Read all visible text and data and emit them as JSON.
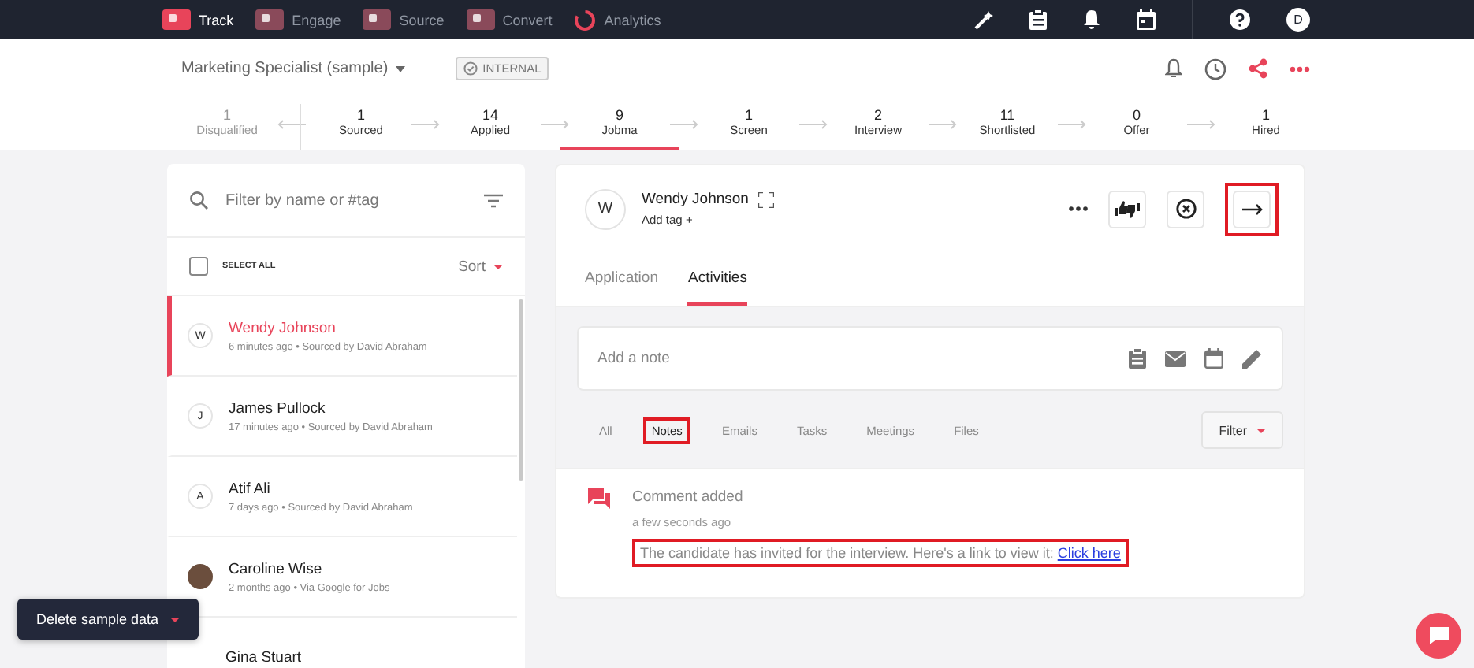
{
  "nav": {
    "items": [
      {
        "label": "Track",
        "selected": true
      },
      {
        "label": "Engage",
        "selected": false
      },
      {
        "label": "Source",
        "selected": false
      },
      {
        "label": "Convert",
        "selected": false
      },
      {
        "label": "Analytics",
        "selected": false
      }
    ],
    "avatar_initial": "D"
  },
  "job": {
    "title": "Marketing Specialist (sample)",
    "badge": "INTERNAL"
  },
  "stages": [
    {
      "count": "1",
      "label": "Disqualified",
      "kind": "rejected",
      "selected": false
    },
    {
      "count": "1",
      "label": "Sourced",
      "kind": "stage",
      "selected": false
    },
    {
      "count": "14",
      "label": "Applied",
      "kind": "stage",
      "selected": false
    },
    {
      "count": "9",
      "label": "Jobma",
      "kind": "stage",
      "selected": true
    },
    {
      "count": "1",
      "label": "Screen",
      "kind": "stage",
      "selected": false
    },
    {
      "count": "2",
      "label": "Interview",
      "kind": "stage",
      "selected": false
    },
    {
      "count": "11",
      "label": "Shortlisted",
      "kind": "stage",
      "selected": false
    },
    {
      "count": "0",
      "label": "Offer",
      "kind": "stage",
      "selected": false
    },
    {
      "count": "1",
      "label": "Hired",
      "kind": "stage",
      "selected": false
    }
  ],
  "candidate_list": {
    "search": {
      "placeholder": "Filter by name or #tag"
    },
    "select_all": {
      "label": "SELECT ALL",
      "checked": false
    },
    "sort": "Sort",
    "candidates": [
      {
        "avatar": {
          "kind": "initial",
          "letter": "W"
        },
        "name": "Wendy Johnson",
        "meta": "6 minutes ago • Sourced by David Abraham",
        "selected": true
      },
      {
        "avatar": {
          "kind": "initial",
          "letter": "J"
        },
        "name": "James Pullock",
        "meta": "17 minutes ago • Sourced by David Abraham",
        "selected": false
      },
      {
        "avatar": {
          "kind": "initial",
          "letter": "A"
        },
        "name": "Atif Ali",
        "meta": "7 days ago • Sourced by David Abraham",
        "selected": false
      },
      {
        "avatar": {
          "kind": "photo"
        },
        "name": "Caroline Wise",
        "meta": "2 months ago • Via Google for Jobs",
        "selected": false
      },
      {
        "name": "Gina Stuart",
        "selected": false
      }
    ]
  },
  "candidate": {
    "initial": "W",
    "name": "Wendy Johnson",
    "add_tag": "Add tag +",
    "next_highlighted": true,
    "tabs": [
      {
        "label": "Application",
        "selected": false
      },
      {
        "label": "Activities",
        "selected": true
      }
    ],
    "note": {
      "placeholder": "Add a note"
    },
    "filters": [
      {
        "label": "All",
        "selected": false,
        "highlighted": false
      },
      {
        "label": "Notes",
        "selected": true,
        "highlighted": true
      },
      {
        "label": "Emails",
        "selected": false,
        "highlighted": false
      },
      {
        "label": "Tasks",
        "selected": false,
        "highlighted": false
      },
      {
        "label": "Meetings",
        "selected": false,
        "highlighted": false
      },
      {
        "label": "Files",
        "selected": false,
        "highlighted": false
      }
    ],
    "filter_button": "Filter",
    "activity": {
      "title": "Comment added",
      "time": "a few seconds ago",
      "text": "The candidate has invited for the interview. Here's a link to view it:",
      "link": "Click here",
      "highlighted": true
    }
  },
  "delete_button": "Delete sample data"
}
